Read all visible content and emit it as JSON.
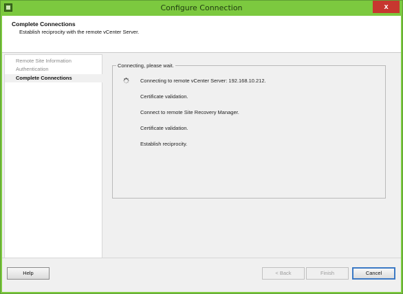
{
  "window": {
    "title": "Configure Connection",
    "close_label": "x"
  },
  "header": {
    "title": "Complete Connections",
    "subtitle": "Establish reciprocity with the remote vCenter Server."
  },
  "sidebar": {
    "items": [
      {
        "label": "Remote Site Information",
        "active": false
      },
      {
        "label": "Authentication",
        "active": false
      },
      {
        "label": "Complete Connections",
        "active": true
      }
    ]
  },
  "main": {
    "group_label": "Connecting, please wait.",
    "steps": [
      {
        "label": "Connecting to remote vCenter Server: 192.168.10.212.",
        "in_progress": true
      },
      {
        "label": "Certificate validation.",
        "in_progress": false
      },
      {
        "label": "Connect  to remote Site Recovery Manager.",
        "in_progress": false
      },
      {
        "label": "Certificate validation.",
        "in_progress": false
      },
      {
        "label": "Establish reciprocity.",
        "in_progress": false
      }
    ]
  },
  "buttons": {
    "help": "Help",
    "back": "< Back",
    "finish": "Finish",
    "cancel": "Cancel"
  },
  "colors": {
    "titlebar": "#7cc93f",
    "close": "#c7372f",
    "default_button_border": "#3a78c4"
  }
}
